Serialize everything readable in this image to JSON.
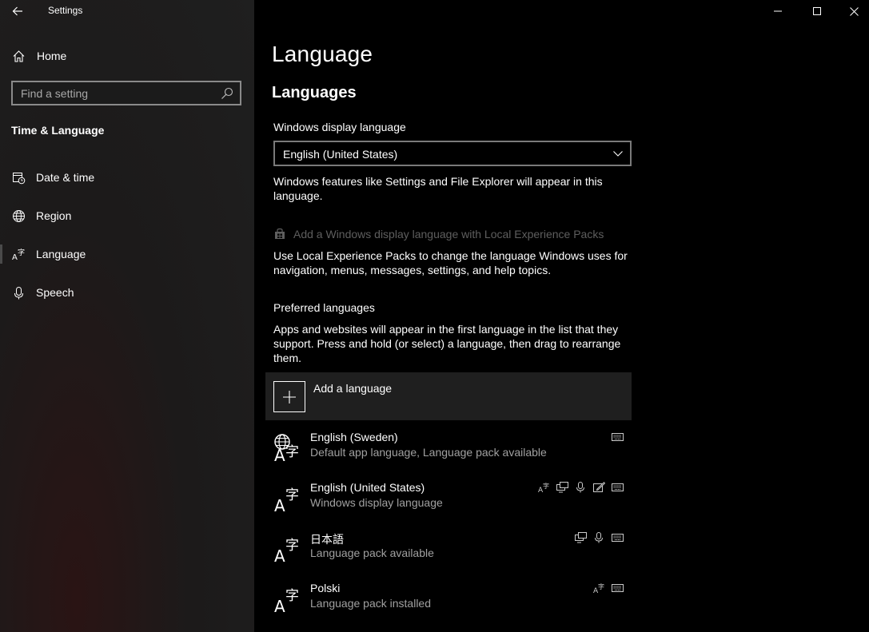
{
  "window": {
    "title": "Settings",
    "controls": [
      "minimize",
      "maximize",
      "close"
    ]
  },
  "sidebar": {
    "home_label": "Home",
    "search_placeholder": "Find a setting",
    "section_title": "Time & Language",
    "items": [
      {
        "label": "Date & time",
        "icon": "calendar-clock-icon"
      },
      {
        "label": "Region",
        "icon": "globe-icon"
      },
      {
        "label": "Language",
        "icon": "language-icon",
        "selected": true
      },
      {
        "label": "Speech",
        "icon": "microphone-icon"
      }
    ]
  },
  "main": {
    "page_title": "Language",
    "languages_heading": "Languages",
    "display_language_label": "Windows display language",
    "display_language_value": "English (United States)",
    "display_language_desc": "Windows features like Settings and File Explorer will appear in this language.",
    "lep_link": "Add a Windows display language with Local Experience Packs",
    "lep_desc": "Use Local Experience Packs to change the language Windows uses for navigation, menus, messages, settings, and help topics.",
    "preferred_label": "Preferred languages",
    "preferred_desc": "Apps and websites will appear in the first language in the list that they support. Press and hold (or select) a language, then drag to rearrange them.",
    "add_language_label": "Add a language",
    "languages": [
      {
        "name": "English (Sweden)",
        "status": "Default app language, Language pack available",
        "features": [
          "keyboard-icon"
        ]
      },
      {
        "name": "English (United States)",
        "status": "Windows display language",
        "features": [
          "display-language-icon",
          "text-to-speech-icon",
          "speech-recognition-icon",
          "handwriting-icon",
          "keyboard-icon"
        ]
      },
      {
        "name": "日本語",
        "status": "Language pack available",
        "features": [
          "text-to-speech-icon",
          "speech-recognition-icon",
          "keyboard-icon"
        ]
      },
      {
        "name": "Polski",
        "status": "Language pack installed",
        "features": [
          "display-language-icon",
          "keyboard-icon"
        ]
      }
    ]
  }
}
